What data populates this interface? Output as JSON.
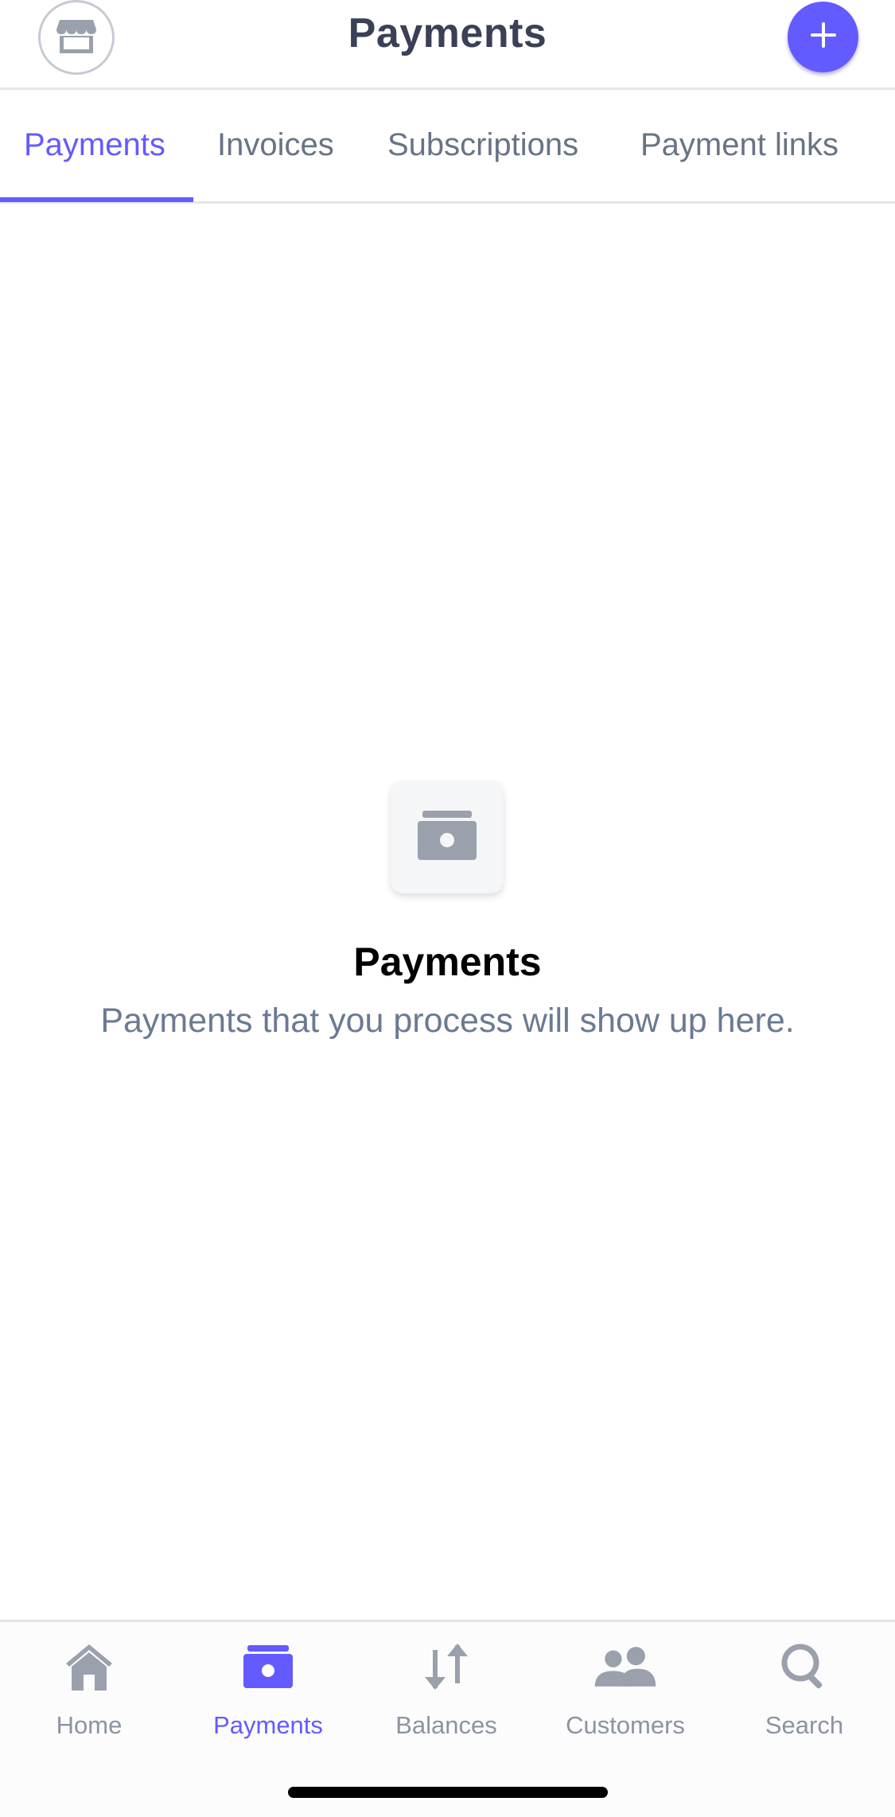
{
  "header": {
    "title": "Payments",
    "store_icon": "store-icon",
    "add_icon": "plus-icon"
  },
  "tabs": [
    {
      "label": "Payments",
      "active": true
    },
    {
      "label": "Invoices",
      "active": false
    },
    {
      "label": "Subscriptions",
      "active": false
    },
    {
      "label": "Payment links",
      "active": false
    }
  ],
  "empty_state": {
    "icon": "payments-icon",
    "title": "Payments",
    "description": "Payments that you process will show up here."
  },
  "bottom_nav": {
    "items": [
      {
        "label": "Home",
        "icon": "home-icon",
        "active": false
      },
      {
        "label": "Payments",
        "icon": "payments-icon",
        "active": true
      },
      {
        "label": "Balances",
        "icon": "balances-icon",
        "active": false
      },
      {
        "label": "Customers",
        "icon": "customers-icon",
        "active": false
      },
      {
        "label": "Search",
        "icon": "search-icon",
        "active": false
      }
    ]
  },
  "colors": {
    "accent": "#635bff",
    "inactive": "#8c93a1",
    "text_secondary": "#687385",
    "title": "#3b4057"
  }
}
